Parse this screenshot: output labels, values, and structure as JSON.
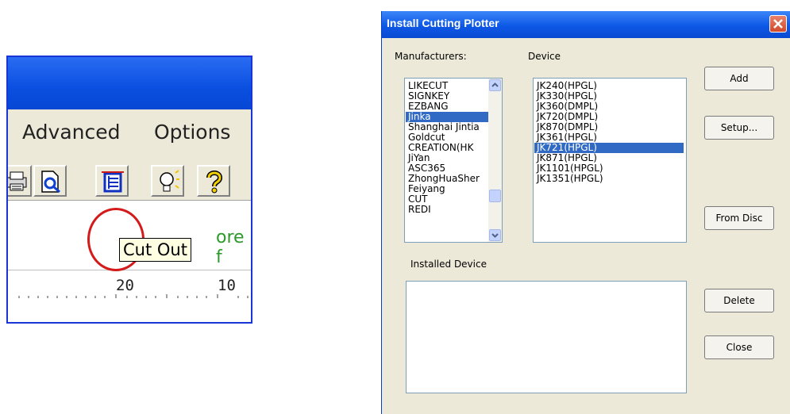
{
  "app": {
    "menu": [
      "Advanced",
      "Options"
    ],
    "tooltip": "Cut Out",
    "content_snippet": "ore f",
    "ruler_labels": [
      "20",
      "10"
    ]
  },
  "dialog": {
    "title": "Install Cutting Plotter",
    "manufacturers_label": "Manufacturers:",
    "device_label": "Device",
    "installed_label": "Installed Device",
    "manufacturers": [
      "LIKECUT",
      "SIGNKEY",
      "EZBANG",
      "Jinka",
      "Shanghai Jintia",
      "Goldcut",
      "CREATION(HK",
      "JiYan",
      "ASC365",
      "ZhongHuaSher",
      "Feiyang",
      "CUT",
      "REDI"
    ],
    "selected_manufacturer": "Jinka",
    "devices": [
      "JK240(HPGL)",
      "JK330(HPGL)",
      "JK360(DMPL)",
      "JK720(DMPL)",
      "JK870(DMPL)",
      "JK361(HPGL)",
      "JK721(HPGL)",
      "JK871(HPGL)",
      "JK1101(HPGL)",
      "JK1351(HPGL)"
    ],
    "selected_device": "JK721(HPGL)",
    "installed_devices": [],
    "buttons": {
      "add": "Add",
      "setup": "Setup...",
      "from_disc": "From Disc",
      "delete": "Delete",
      "close": "Close"
    }
  },
  "colors": {
    "selection": "#316ac5",
    "highlight_circle": "#d41a1a",
    "panel_border": "#1a35d6"
  }
}
